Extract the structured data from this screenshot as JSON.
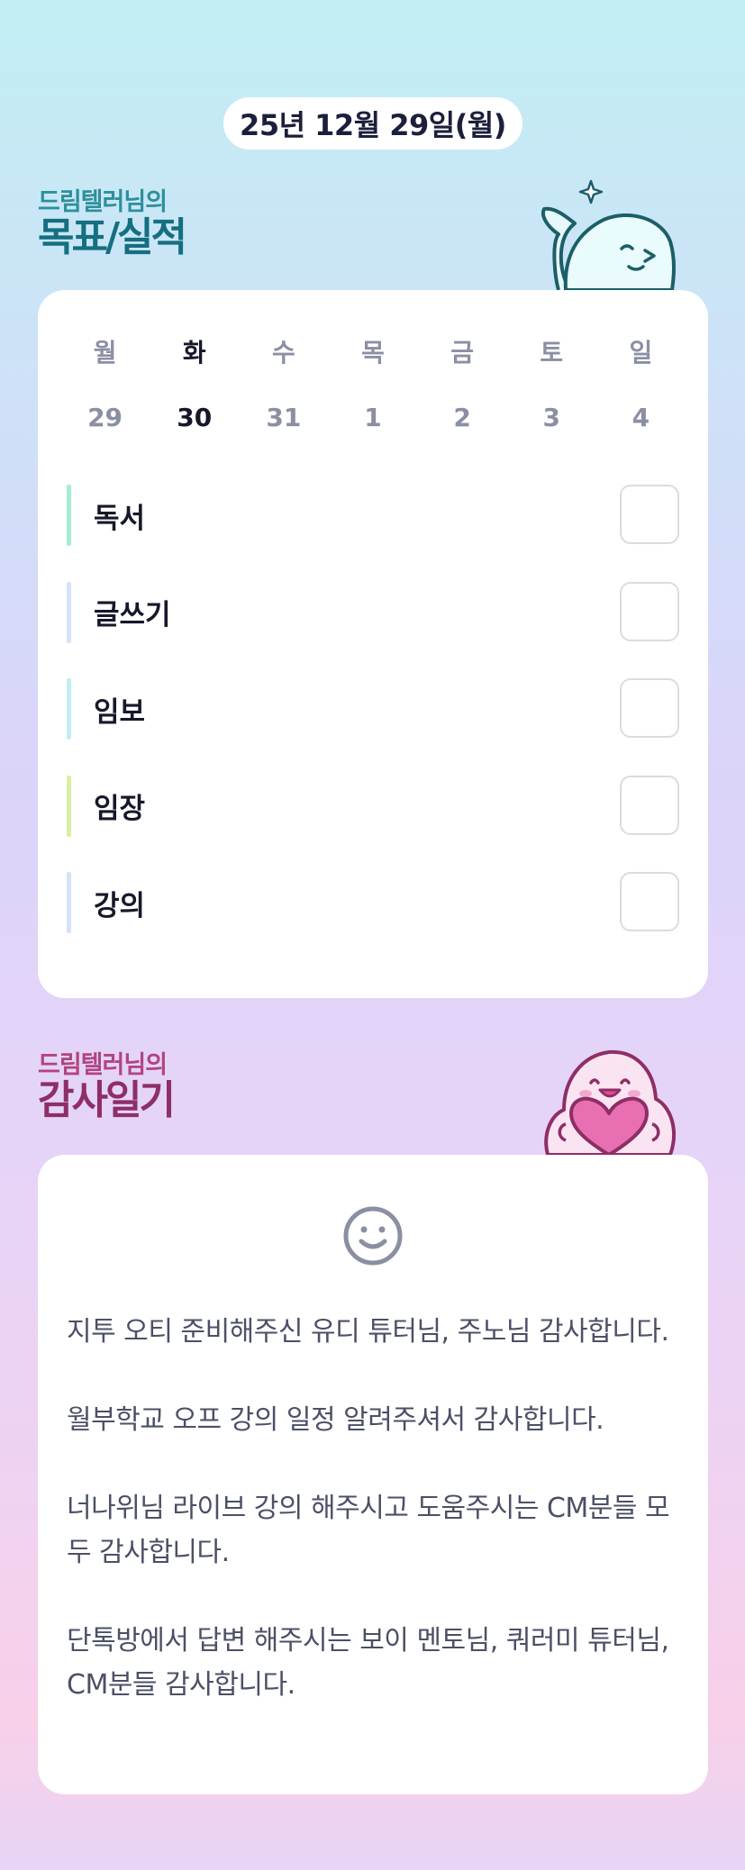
{
  "date_label": "25년 12월 29일(월)",
  "goal_section": {
    "subtitle": "드림텔러님의",
    "title": "목표/실적",
    "week": [
      {
        "name": "월",
        "num": "29",
        "active": false
      },
      {
        "name": "화",
        "num": "30",
        "active": true
      },
      {
        "name": "수",
        "num": "31",
        "active": false
      },
      {
        "name": "목",
        "num": "1",
        "active": false
      },
      {
        "name": "금",
        "num": "2",
        "active": false
      },
      {
        "name": "토",
        "num": "3",
        "active": false
      },
      {
        "name": "일",
        "num": "4",
        "active": false
      }
    ],
    "goals": [
      {
        "label": "독서",
        "color": "#a8ecd4",
        "checked": false
      },
      {
        "label": "글쓰기",
        "color": "#d6e2f6",
        "checked": false
      },
      {
        "label": "임보",
        "color": "#c2eef3",
        "checked": false
      },
      {
        "label": "임장",
        "color": "#d8f0a0",
        "checked": false
      },
      {
        "label": "강의",
        "color": "#d6e2f6",
        "checked": false
      }
    ]
  },
  "gratitude_section": {
    "subtitle": "드림텔러님의",
    "title": "감사일기",
    "mood_icon": "smile-icon",
    "entries": [
      "지투 오티 준비해주신 유디 튜터님, 주노님 감사합니다.",
      "월부학교 오프 강의 일정 알려주셔서 감사합니다.",
      "너나위님 라이브 강의 해주시고 도움주시는 CM분들 모두 감사합니다.",
      "단톡방에서 답변 해주시는 보이 멘토님, 쿼러미 튜터님, CM분들 감사합니다."
    ]
  },
  "colors": {
    "goal_title": "#146f80",
    "gratitude_title": "#8e2e66",
    "active_day": "#16182a",
    "inactive_day": "#8b8fa3"
  }
}
